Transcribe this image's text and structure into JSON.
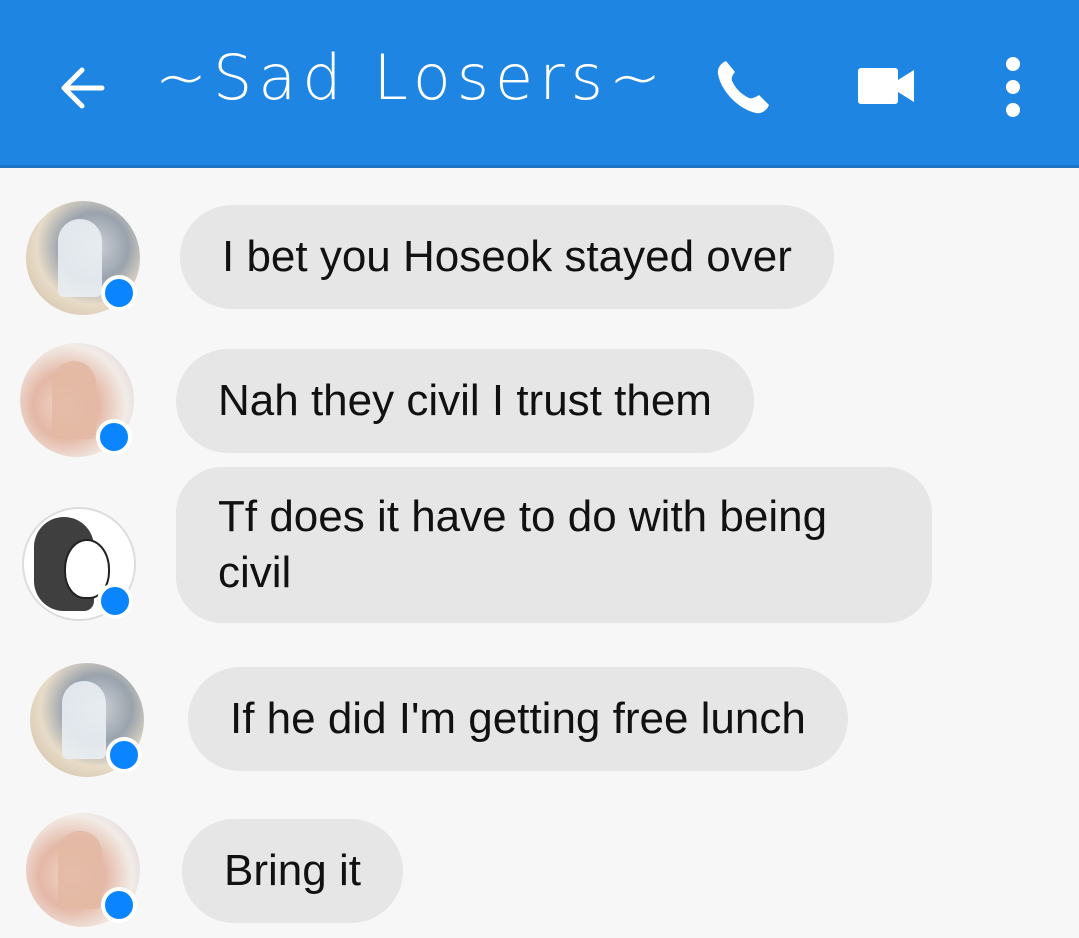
{
  "header": {
    "title": "~Sad Losers~",
    "accent": "#1f85e3",
    "icons": [
      "back-arrow-icon",
      "phone-icon",
      "video-camera-icon",
      "more-vertical-icon"
    ]
  },
  "messages": [
    {
      "text": "I bet you Hoseok stayed over",
      "avatar": "user-a"
    },
    {
      "text": "Nah they civil I trust them",
      "avatar": "user-b"
    },
    {
      "text": "Tf does it have to do with being civil",
      "avatar": "user-c"
    },
    {
      "text": "If he did I'm getting free lunch",
      "avatar": "user-a"
    },
    {
      "text": "Bring it",
      "avatar": "user-b"
    }
  ],
  "bubble_color": "#e6e6e6",
  "badge_color": "#0b84ff"
}
